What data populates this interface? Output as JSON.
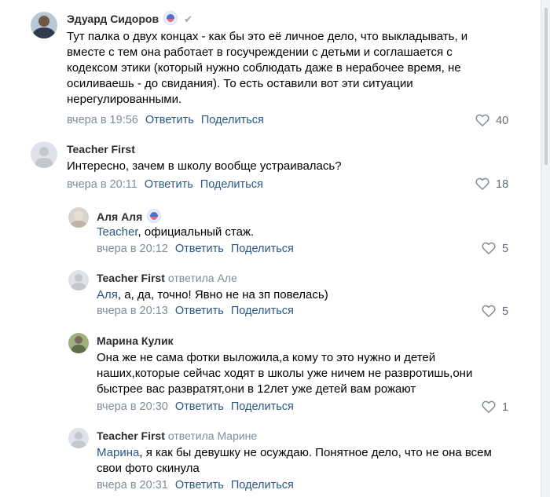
{
  "comments": [
    {
      "author": "Эдуард Сидоров",
      "text": "Тут палка о двух концах - как бы это её личное дело, что выкладывать, и вместе с тем она работает в госучреждении с детьми и соглашается с кодексом этики (который нужно соблюдать даже в нерабочее время, не осиливаешь - до свидания). То есть оставили вот эти ситуации нерегулированными.",
      "time": "вчера в 19:56",
      "reply": "Ответить",
      "share": "Поделиться",
      "likes": "40"
    },
    {
      "author": "Teacher First",
      "text": "Интересно, зачем в школу вообще устраивалась?",
      "time": "вчера в 20:11",
      "reply": "Ответить",
      "share": "Поделиться",
      "likes": "18"
    },
    {
      "author": "Аля Аля",
      "mention": "Teacher",
      "text": ", официальный стаж.",
      "time": "вчера в 20:12",
      "reply": "Ответить",
      "share": "Поделиться",
      "likes": "5"
    },
    {
      "author": "Teacher First",
      "reply_to": "ответила Але",
      "mention": "Аля",
      "text": ", а, да, точно! Явно не на зп повелась)",
      "time": "вчера в 20:13",
      "reply": "Ответить",
      "share": "Поделиться",
      "likes": "5"
    },
    {
      "author": "Марина Кулик",
      "text": "Она же не сама фотки выложила,а кому то это нужно и детей наших,которые сейчас ходят в школы уже ничем не развротишь,они быстрее вас развратят,они в 12лет уже детей вам рожают",
      "time": "вчера в 20:30",
      "reply": "Ответить",
      "share": "Поделиться",
      "likes": "1"
    },
    {
      "author": "Teacher First",
      "reply_to": "ответила Марине",
      "mention": "Марина",
      "text": ", я как бы девушку не осуждаю. Понятное дело, что не она всем свои фото скинула",
      "time": "вчера в 20:31",
      "reply": "Ответить",
      "share": "Поделиться"
    }
  ]
}
